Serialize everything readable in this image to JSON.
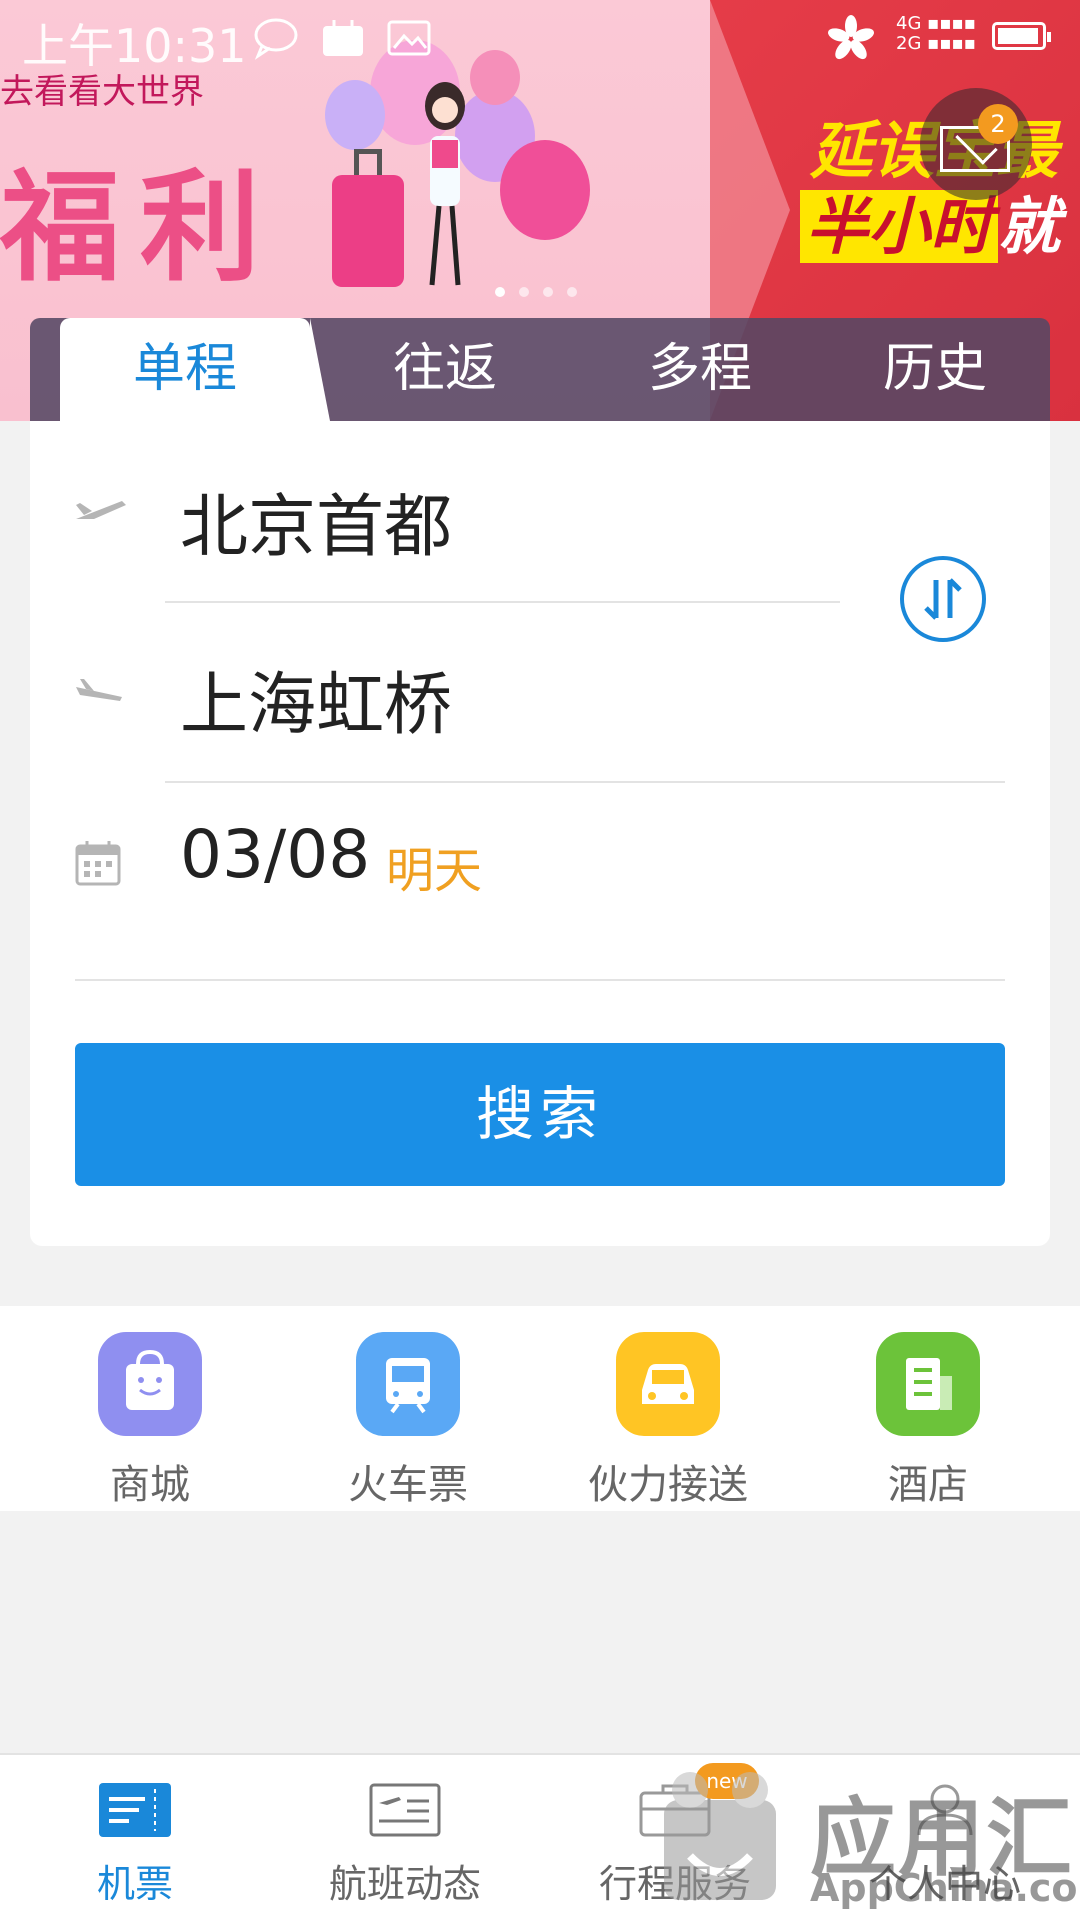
{
  "status_bar": {
    "time": "上午10:31"
  },
  "banner": {
    "left_subtitle": "去看看大世界",
    "left_title": "福利",
    "right_line1": "延误宝最",
    "right_line2_highlight": "半小时",
    "right_line2_rest": "就",
    "mail_badge": "2"
  },
  "tabs": [
    {
      "label": "单程"
    },
    {
      "label": "往返"
    },
    {
      "label": "多程"
    },
    {
      "label": "历史"
    }
  ],
  "form": {
    "departure": "北京首都",
    "arrival": "上海虹桥",
    "date": "03/08",
    "date_hint": "明天",
    "search_label": "搜索"
  },
  "services": [
    {
      "label": "商城",
      "color": "#8f8ff0"
    },
    {
      "label": "火车票",
      "color": "#5aa8f5"
    },
    {
      "label": "伙力接送",
      "color": "#ffc524"
    },
    {
      "label": "酒店",
      "color": "#6cc33a"
    }
  ],
  "nav": [
    {
      "label": "机票"
    },
    {
      "label": "航班动态"
    },
    {
      "label": "行程服务"
    },
    {
      "label": "个人中心"
    }
  ],
  "nav_new_badge": "new",
  "watermark": {
    "line1": "应用汇",
    "line2": "AppChina.com"
  },
  "colors": {
    "accent": "#1a88d9",
    "button": "#1a8fe6",
    "hint": "#f0a021"
  }
}
